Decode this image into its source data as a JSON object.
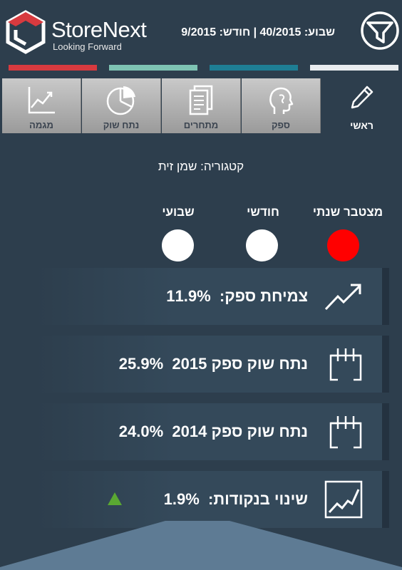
{
  "header": {
    "brand_name": "StoreNext",
    "brand_tagline": "Looking Forward",
    "period_line": "שבוע: 40/2015 | חודש: 9/2015",
    "filter_icon": "filter-icon"
  },
  "strip_colors": [
    "#d83a3f",
    "#7ec3b3",
    "#1e7e94",
    "#e8ecef"
  ],
  "tabs": [
    {
      "label": "מגמה",
      "icon": "trend-chart-icon"
    },
    {
      "label": "נתח שוק",
      "icon": "pie-chart-icon"
    },
    {
      "label": "מתחרים",
      "icon": "documents-icon"
    },
    {
      "label": "ספק",
      "icon": "head-profile-icon"
    },
    {
      "label": "ראשי",
      "icon": "pencil-icon"
    }
  ],
  "category": {
    "label": "קטגוריה:",
    "value": "שמן זית"
  },
  "periods": [
    {
      "label": "מצטבר שנתי",
      "active": true
    },
    {
      "label": "חודשי",
      "active": false
    },
    {
      "label": "שבועי",
      "active": false
    }
  ],
  "kpis": [
    {
      "label": "צמיחת ספק:",
      "value": "11.9%",
      "icon": "growth-arrow-icon"
    },
    {
      "label": "נתח שוק ספק 2015",
      "value": "25.9%",
      "icon": "calendar-icon"
    },
    {
      "label": "נתח שוק ספק 2014",
      "value": "24.0%",
      "icon": "calendar-icon"
    },
    {
      "label": "שינוי בנקודות:",
      "value": "1.9%",
      "icon": "chart-line-icon",
      "trend_icon": "triangle-up-icon"
    }
  ],
  "colors": {
    "background": "#2d3e4d",
    "active_period": "#ff0000",
    "trend_up": "#5aa832",
    "logo_red": "#d83a3f"
  }
}
